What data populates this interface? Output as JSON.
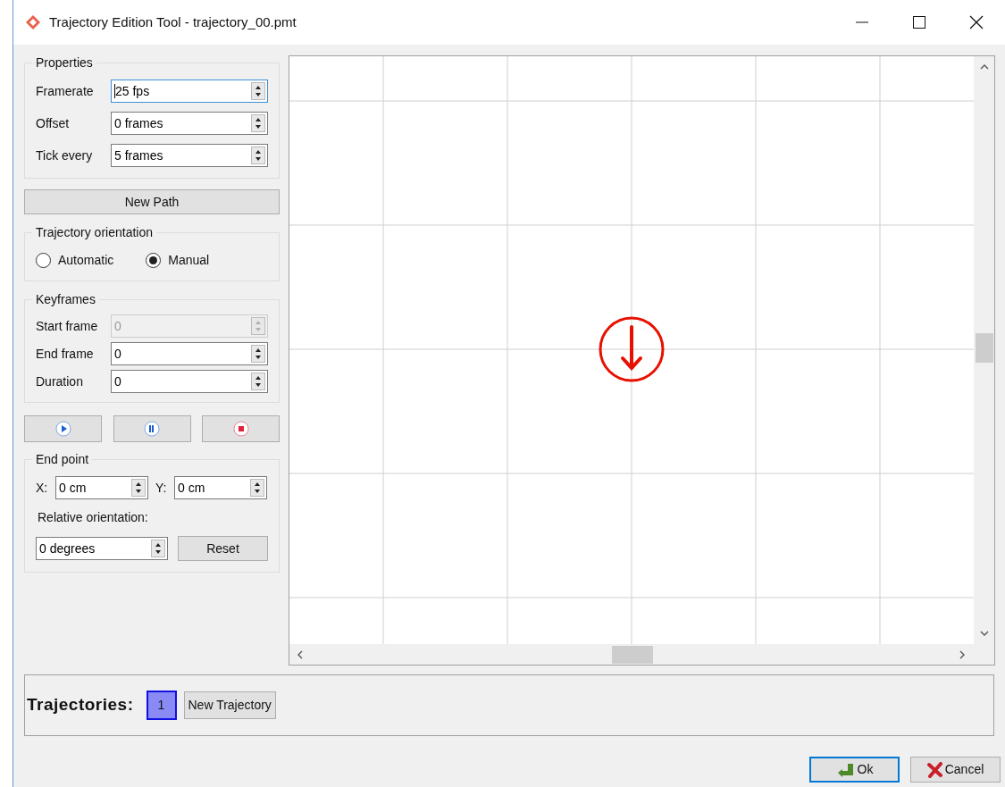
{
  "window": {
    "title": "Trajectory Edition Tool - trajectory_00.pmt"
  },
  "properties": {
    "title": "Properties",
    "fields": [
      {
        "label": "Framerate",
        "value": "25 fps",
        "focused": true
      },
      {
        "label": "Offset",
        "value": "0 frames",
        "focused": false
      },
      {
        "label": "Tick every",
        "value": "5 frames",
        "focused": false
      }
    ]
  },
  "new_path_button": "New Path",
  "orientation": {
    "title": "Trajectory orientation",
    "options": [
      {
        "label": "Automatic",
        "selected": false
      },
      {
        "label": "Manual",
        "selected": true
      }
    ]
  },
  "keyframes": {
    "title": "Keyframes",
    "fields": [
      {
        "label": "Start frame",
        "value": "0",
        "disabled": true
      },
      {
        "label": "End frame",
        "value": "0",
        "disabled": false
      },
      {
        "label": "Duration",
        "value": "0",
        "disabled": false
      }
    ]
  },
  "playback_buttons": [
    {
      "kind": "play"
    },
    {
      "kind": "pause"
    },
    {
      "kind": "stop"
    }
  ],
  "end_point": {
    "title": "End point",
    "x": {
      "label": "X:",
      "value": "0 cm"
    },
    "y": {
      "label": "Y:",
      "value": "0 cm"
    },
    "orientation_label": "Relative orientation:",
    "orientation_value": "0 degrees",
    "reset_button": "Reset"
  },
  "trajectories": {
    "label": "Trajectories:",
    "items": [
      {
        "label": "1",
        "selected": true
      }
    ],
    "new_button": "New Trajectory"
  },
  "buttons": [
    {
      "label": "Ok",
      "kind": "ok"
    },
    {
      "label": "Cancel",
      "kind": "cancel"
    }
  ]
}
